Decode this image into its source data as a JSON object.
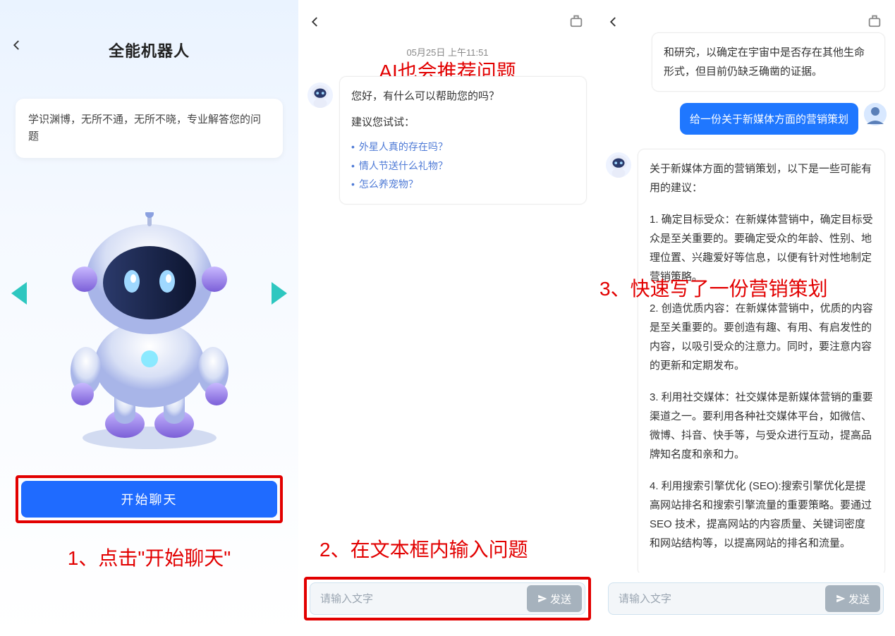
{
  "panel1": {
    "title": "全能机器人",
    "intro": "学识渊博，无所不通，无所不晓，专业解答您的问题",
    "start_button": "开始聊天",
    "annotation": "1、点击\"开始聊天\""
  },
  "panel2": {
    "timestamp": "05月25日  上午11:51",
    "annotation_top": "AI也会推荐问题",
    "greeting": "您好，有什么可以帮助您的吗？",
    "suggest_label": "建议您试试：",
    "suggestions": {
      "s1": "外星人真的存在吗？",
      "s2": "情人节送什么礼物？",
      "s3": "怎么养宠物？"
    },
    "input_placeholder": "请输入文字",
    "send_label": "发送",
    "annotation_bottom": "2、在文本框内输入问题"
  },
  "panel3": {
    "partial_reply": "和研究，以确定在宇宙中是否存在其他生命形式，但目前仍缺乏确凿的证据。",
    "user_prompt": "给一份关于新媒体方面的营销策划",
    "reply_intro": "关于新媒体方面的营销策划，以下是一些可能有用的建议：",
    "reply_points": {
      "p1": "1. 确定目标受众：在新媒体营销中，确定目标受众是至关重要的。要确定受众的年龄、性别、地理位置、兴趣爱好等信息，以便有针对性地制定营销策略。",
      "p2": "2. 创造优质内容：在新媒体营销中，优质的内容是至关重要的。要创造有趣、有用、有启发性的内容，以吸引受众的注意力。同时，要注意内容的更新和定期发布。",
      "p3": "3. 利用社交媒体：社交媒体是新媒体营销的重要渠道之一。要利用各种社交媒体平台，如微信、微博、抖音、快手等，与受众进行互动，提高品牌知名度和亲和力。",
      "p4": "4. 利用搜索引擎优化 (SEO):搜索引擎优化是提高网站排名和搜索引擎流量的重要策略。要通过 SEO 技术，提高网站的内容质量、关键词密度和网站结构等，以提高网站的排名和流量。"
    },
    "annotation": "3、快速写了一份营销策划",
    "input_placeholder": "请输入文字",
    "send_label": "发送"
  }
}
